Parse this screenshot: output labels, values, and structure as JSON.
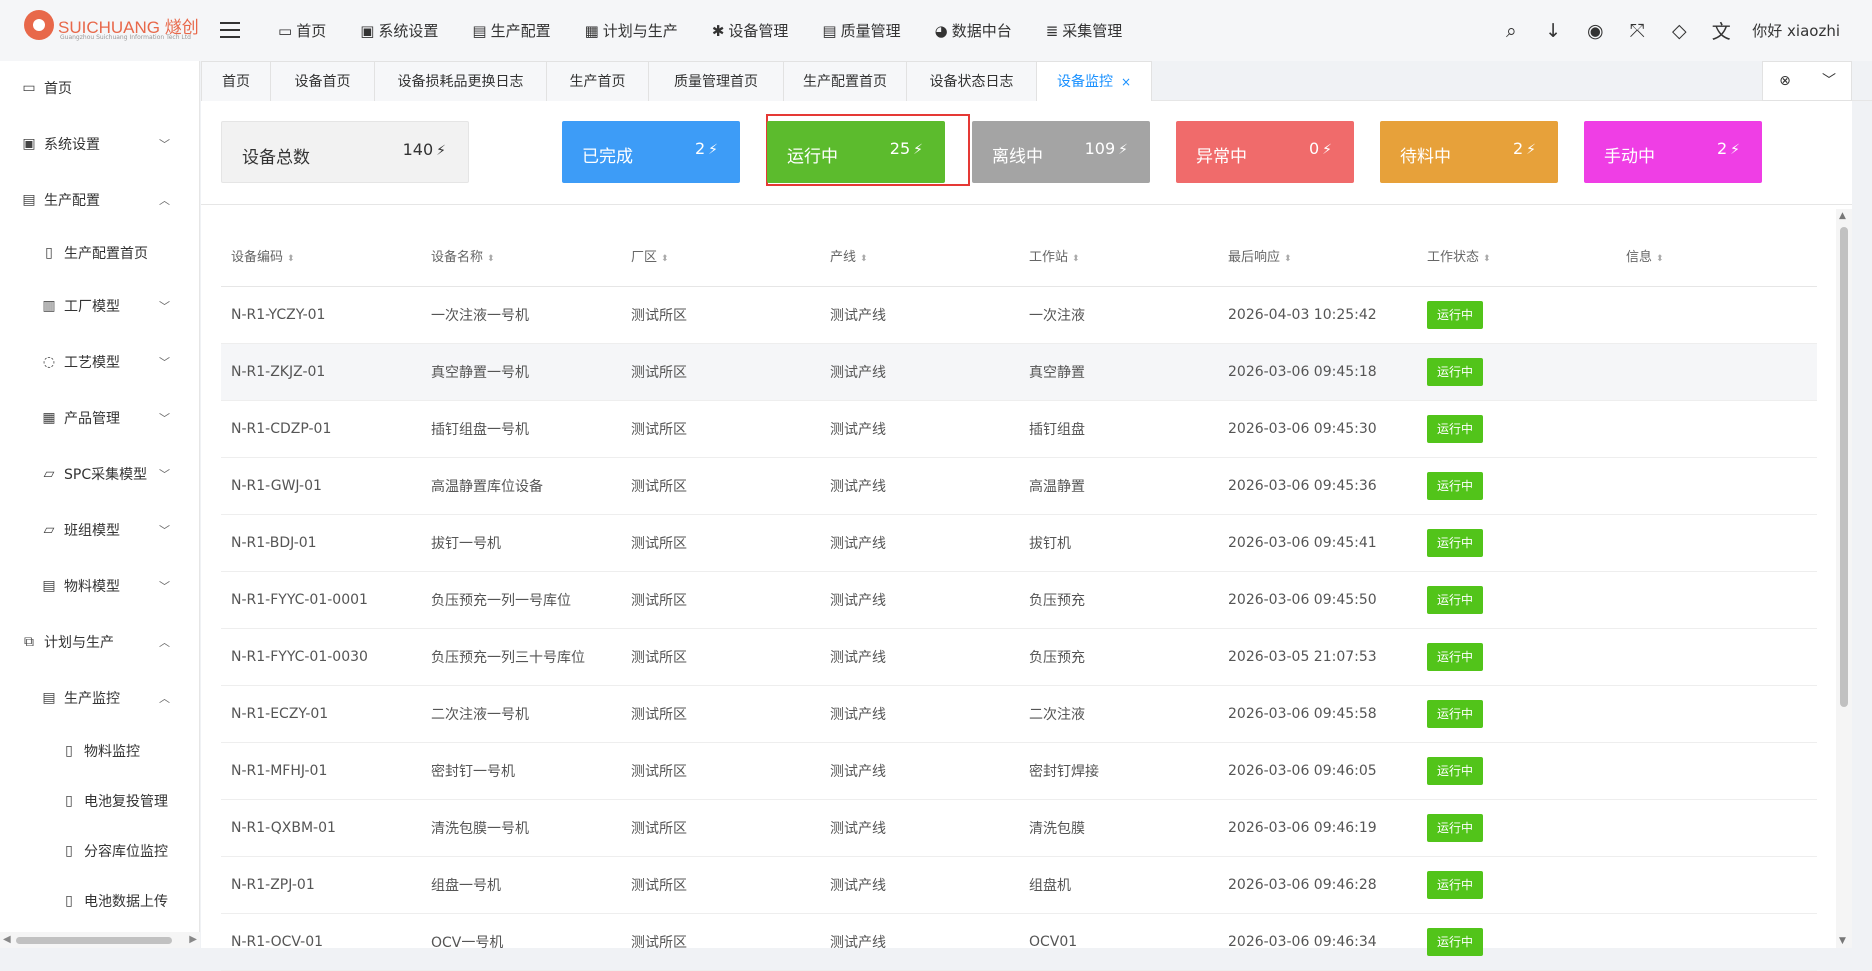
{
  "brand": {
    "name": "SUICHUANG 燧创",
    "sub": "Guangzhou Suichuang Information Tech Ltd"
  },
  "topnav": [
    {
      "icon": "▭",
      "label": "首页"
    },
    {
      "icon": "▣",
      "label": "系统设置"
    },
    {
      "icon": "▤",
      "label": "生产配置"
    },
    {
      "icon": "▦",
      "label": "计划与生产"
    },
    {
      "icon": "✱",
      "label": "设备管理"
    },
    {
      "icon": "▤",
      "label": "质量管理"
    },
    {
      "icon": "◕",
      "label": "数据中台"
    },
    {
      "icon": "≣",
      "label": "采集管理"
    }
  ],
  "topright": {
    "greeting": "你好 xiaozhi"
  },
  "sidebar": [
    {
      "icon": "▭",
      "label": "首页",
      "chev": ""
    },
    {
      "icon": "▣",
      "label": "系统设置",
      "chev": "﹀"
    },
    {
      "icon": "▤",
      "label": "生产配置",
      "chev": "︿"
    },
    {
      "icon": "▯",
      "label": "生产配置首页",
      "chev": ""
    },
    {
      "icon": "▥",
      "label": "工厂模型",
      "chev": "﹀"
    },
    {
      "icon": "◌",
      "label": "工艺模型",
      "chev": "﹀"
    },
    {
      "icon": "▦",
      "label": "产品管理",
      "chev": "﹀"
    },
    {
      "icon": "▱",
      "label": "SPC采集模型",
      "chev": "﹀"
    },
    {
      "icon": "▱",
      "label": "班组模型",
      "chev": "﹀"
    },
    {
      "icon": "▤",
      "label": "物料模型",
      "chev": "﹀"
    },
    {
      "icon": "⧉",
      "label": "计划与生产",
      "chev": "︿"
    },
    {
      "icon": "▤",
      "label": "生产监控",
      "chev": "︿"
    },
    {
      "icon": "▯",
      "label": "物料监控",
      "chev": ""
    },
    {
      "icon": "▯",
      "label": "电池复投管理",
      "chev": ""
    },
    {
      "icon": "▯",
      "label": "分容库位监控",
      "chev": ""
    },
    {
      "icon": "▯",
      "label": "电池数据上传",
      "chev": ""
    }
  ],
  "tabs": [
    "首页",
    "设备首页",
    "设备损耗品更换日志",
    "生产首页",
    "质量管理首页",
    "生产配置首页",
    "设备状态日志",
    "设备监控"
  ],
  "stats": [
    {
      "label": "设备总数",
      "value": "140",
      "color": "#f2f2f2"
    },
    {
      "label": "已完成",
      "value": "2",
      "color": "#3d9cf7"
    },
    {
      "label": "运行中",
      "value": "25",
      "color": "#5cbb2d"
    },
    {
      "label": "离线中",
      "value": "109",
      "color": "#a4a4a4"
    },
    {
      "label": "异常中",
      "value": "0",
      "color": "#f06b6b"
    },
    {
      "label": "待料中",
      "value": "2",
      "color": "#e7a13a"
    },
    {
      "label": "手动中",
      "value": "2",
      "color": "#ef3ee5"
    }
  ],
  "table": {
    "headers": [
      "设备编码",
      "设备名称",
      "厂区",
      "产线",
      "工作站",
      "最后响应",
      "工作状态",
      "信息"
    ],
    "rows": [
      [
        "N-R1-YCZY-01",
        "一次注液一号机",
        "测试所区",
        "测试产线",
        "一次注液",
        "2026-04-03 10:25:42",
        "运行中",
        ""
      ],
      [
        "N-R1-ZKJZ-01",
        "真空静置一号机",
        "测试所区",
        "测试产线",
        "真空静置",
        "2026-03-06 09:45:18",
        "运行中",
        ""
      ],
      [
        "N-R1-CDZP-01",
        "插钉组盘一号机",
        "测试所区",
        "测试产线",
        "插钉组盘",
        "2026-03-06 09:45:30",
        "运行中",
        ""
      ],
      [
        "N-R1-GWJ-01",
        "高温静置库位设备",
        "测试所区",
        "测试产线",
        "高温静置",
        "2026-03-06 09:45:36",
        "运行中",
        ""
      ],
      [
        "N-R1-BDJ-01",
        "拔钉一号机",
        "测试所区",
        "测试产线",
        "拔钉机",
        "2026-03-06 09:45:41",
        "运行中",
        ""
      ],
      [
        "N-R1-FYYC-01-0001",
        "负压预充一列一号库位",
        "测试所区",
        "测试产线",
        "负压预充",
        "2026-03-06 09:45:50",
        "运行中",
        ""
      ],
      [
        "N-R1-FYYC-01-0030",
        "负压预充一列三十号库位",
        "测试所区",
        "测试产线",
        "负压预充",
        "2026-03-05 21:07:53",
        "运行中",
        ""
      ],
      [
        "N-R1-ECZY-01",
        "二次注液一号机",
        "测试所区",
        "测试产线",
        "二次注液",
        "2026-03-06 09:45:58",
        "运行中",
        ""
      ],
      [
        "N-R1-MFHJ-01",
        "密封钉一号机",
        "测试所区",
        "测试产线",
        "密封钉焊接",
        "2026-03-06 09:46:05",
        "运行中",
        ""
      ],
      [
        "N-R1-QXBM-01",
        "清洗包膜一号机",
        "测试所区",
        "测试产线",
        "清洗包膜",
        "2026-03-06 09:46:19",
        "运行中",
        ""
      ],
      [
        "N-R1-ZPJ-01",
        "组盘一号机",
        "测试所区",
        "测试产线",
        "组盘机",
        "2026-03-06 09:46:28",
        "运行中",
        ""
      ],
      [
        "N-R1-OCV-01",
        "OCV一号机",
        "测试所区",
        "测试产线",
        "OCV01",
        "2026-03-06 09:46:34",
        "运行中",
        ""
      ]
    ]
  }
}
